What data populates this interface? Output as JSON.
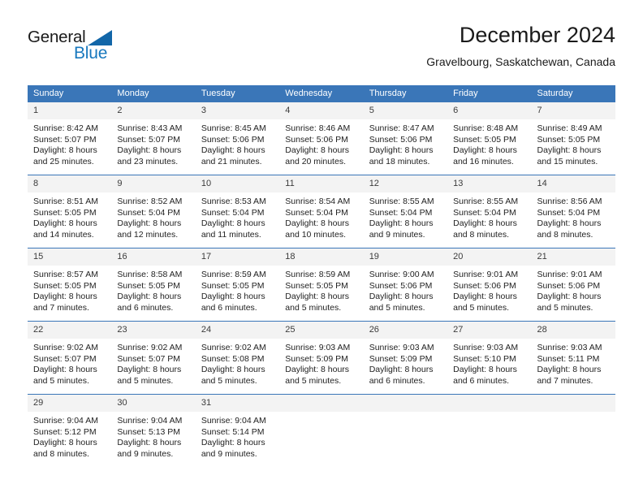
{
  "brand": {
    "logo_text_top": "General",
    "logo_text_bottom": "Blue",
    "triangle_icon": "blue-triangle-icon",
    "accent_color": "#1878be"
  },
  "header": {
    "title": "December 2024",
    "subtitle": "Gravelbourg, Saskatchewan, Canada"
  },
  "calendar": {
    "header_bg": "#3a76b8",
    "daynum_bg": "#f3f3f3",
    "weekday_headers": [
      "Sunday",
      "Monday",
      "Tuesday",
      "Wednesday",
      "Thursday",
      "Friday",
      "Saturday"
    ],
    "weeks": [
      [
        {
          "day": "1",
          "sunrise": "Sunrise: 8:42 AM",
          "sunset": "Sunset: 5:07 PM",
          "daylight1": "Daylight: 8 hours",
          "daylight2": "and 25 minutes."
        },
        {
          "day": "2",
          "sunrise": "Sunrise: 8:43 AM",
          "sunset": "Sunset: 5:07 PM",
          "daylight1": "Daylight: 8 hours",
          "daylight2": "and 23 minutes."
        },
        {
          "day": "3",
          "sunrise": "Sunrise: 8:45 AM",
          "sunset": "Sunset: 5:06 PM",
          "daylight1": "Daylight: 8 hours",
          "daylight2": "and 21 minutes."
        },
        {
          "day": "4",
          "sunrise": "Sunrise: 8:46 AM",
          "sunset": "Sunset: 5:06 PM",
          "daylight1": "Daylight: 8 hours",
          "daylight2": "and 20 minutes."
        },
        {
          "day": "5",
          "sunrise": "Sunrise: 8:47 AM",
          "sunset": "Sunset: 5:06 PM",
          "daylight1": "Daylight: 8 hours",
          "daylight2": "and 18 minutes."
        },
        {
          "day": "6",
          "sunrise": "Sunrise: 8:48 AM",
          "sunset": "Sunset: 5:05 PM",
          "daylight1": "Daylight: 8 hours",
          "daylight2": "and 16 minutes."
        },
        {
          "day": "7",
          "sunrise": "Sunrise: 8:49 AM",
          "sunset": "Sunset: 5:05 PM",
          "daylight1": "Daylight: 8 hours",
          "daylight2": "and 15 minutes."
        }
      ],
      [
        {
          "day": "8",
          "sunrise": "Sunrise: 8:51 AM",
          "sunset": "Sunset: 5:05 PM",
          "daylight1": "Daylight: 8 hours",
          "daylight2": "and 14 minutes."
        },
        {
          "day": "9",
          "sunrise": "Sunrise: 8:52 AM",
          "sunset": "Sunset: 5:04 PM",
          "daylight1": "Daylight: 8 hours",
          "daylight2": "and 12 minutes."
        },
        {
          "day": "10",
          "sunrise": "Sunrise: 8:53 AM",
          "sunset": "Sunset: 5:04 PM",
          "daylight1": "Daylight: 8 hours",
          "daylight2": "and 11 minutes."
        },
        {
          "day": "11",
          "sunrise": "Sunrise: 8:54 AM",
          "sunset": "Sunset: 5:04 PM",
          "daylight1": "Daylight: 8 hours",
          "daylight2": "and 10 minutes."
        },
        {
          "day": "12",
          "sunrise": "Sunrise: 8:55 AM",
          "sunset": "Sunset: 5:04 PM",
          "daylight1": "Daylight: 8 hours",
          "daylight2": "and 9 minutes."
        },
        {
          "day": "13",
          "sunrise": "Sunrise: 8:55 AM",
          "sunset": "Sunset: 5:04 PM",
          "daylight1": "Daylight: 8 hours",
          "daylight2": "and 8 minutes."
        },
        {
          "day": "14",
          "sunrise": "Sunrise: 8:56 AM",
          "sunset": "Sunset: 5:04 PM",
          "daylight1": "Daylight: 8 hours",
          "daylight2": "and 8 minutes."
        }
      ],
      [
        {
          "day": "15",
          "sunrise": "Sunrise: 8:57 AM",
          "sunset": "Sunset: 5:05 PM",
          "daylight1": "Daylight: 8 hours",
          "daylight2": "and 7 minutes."
        },
        {
          "day": "16",
          "sunrise": "Sunrise: 8:58 AM",
          "sunset": "Sunset: 5:05 PM",
          "daylight1": "Daylight: 8 hours",
          "daylight2": "and 6 minutes."
        },
        {
          "day": "17",
          "sunrise": "Sunrise: 8:59 AM",
          "sunset": "Sunset: 5:05 PM",
          "daylight1": "Daylight: 8 hours",
          "daylight2": "and 6 minutes."
        },
        {
          "day": "18",
          "sunrise": "Sunrise: 8:59 AM",
          "sunset": "Sunset: 5:05 PM",
          "daylight1": "Daylight: 8 hours",
          "daylight2": "and 5 minutes."
        },
        {
          "day": "19",
          "sunrise": "Sunrise: 9:00 AM",
          "sunset": "Sunset: 5:06 PM",
          "daylight1": "Daylight: 8 hours",
          "daylight2": "and 5 minutes."
        },
        {
          "day": "20",
          "sunrise": "Sunrise: 9:01 AM",
          "sunset": "Sunset: 5:06 PM",
          "daylight1": "Daylight: 8 hours",
          "daylight2": "and 5 minutes."
        },
        {
          "day": "21",
          "sunrise": "Sunrise: 9:01 AM",
          "sunset": "Sunset: 5:06 PM",
          "daylight1": "Daylight: 8 hours",
          "daylight2": "and 5 minutes."
        }
      ],
      [
        {
          "day": "22",
          "sunrise": "Sunrise: 9:02 AM",
          "sunset": "Sunset: 5:07 PM",
          "daylight1": "Daylight: 8 hours",
          "daylight2": "and 5 minutes."
        },
        {
          "day": "23",
          "sunrise": "Sunrise: 9:02 AM",
          "sunset": "Sunset: 5:07 PM",
          "daylight1": "Daylight: 8 hours",
          "daylight2": "and 5 minutes."
        },
        {
          "day": "24",
          "sunrise": "Sunrise: 9:02 AM",
          "sunset": "Sunset: 5:08 PM",
          "daylight1": "Daylight: 8 hours",
          "daylight2": "and 5 minutes."
        },
        {
          "day": "25",
          "sunrise": "Sunrise: 9:03 AM",
          "sunset": "Sunset: 5:09 PM",
          "daylight1": "Daylight: 8 hours",
          "daylight2": "and 5 minutes."
        },
        {
          "day": "26",
          "sunrise": "Sunrise: 9:03 AM",
          "sunset": "Sunset: 5:09 PM",
          "daylight1": "Daylight: 8 hours",
          "daylight2": "and 6 minutes."
        },
        {
          "day": "27",
          "sunrise": "Sunrise: 9:03 AM",
          "sunset": "Sunset: 5:10 PM",
          "daylight1": "Daylight: 8 hours",
          "daylight2": "and 6 minutes."
        },
        {
          "day": "28",
          "sunrise": "Sunrise: 9:03 AM",
          "sunset": "Sunset: 5:11 PM",
          "daylight1": "Daylight: 8 hours",
          "daylight2": "and 7 minutes."
        }
      ],
      [
        {
          "day": "29",
          "sunrise": "Sunrise: 9:04 AM",
          "sunset": "Sunset: 5:12 PM",
          "daylight1": "Daylight: 8 hours",
          "daylight2": "and 8 minutes."
        },
        {
          "day": "30",
          "sunrise": "Sunrise: 9:04 AM",
          "sunset": "Sunset: 5:13 PM",
          "daylight1": "Daylight: 8 hours",
          "daylight2": "and 9 minutes."
        },
        {
          "day": "31",
          "sunrise": "Sunrise: 9:04 AM",
          "sunset": "Sunset: 5:14 PM",
          "daylight1": "Daylight: 8 hours",
          "daylight2": "and 9 minutes."
        },
        {
          "day": "",
          "sunrise": "",
          "sunset": "",
          "daylight1": "",
          "daylight2": ""
        },
        {
          "day": "",
          "sunrise": "",
          "sunset": "",
          "daylight1": "",
          "daylight2": ""
        },
        {
          "day": "",
          "sunrise": "",
          "sunset": "",
          "daylight1": "",
          "daylight2": ""
        },
        {
          "day": "",
          "sunrise": "",
          "sunset": "",
          "daylight1": "",
          "daylight2": ""
        }
      ]
    ]
  }
}
